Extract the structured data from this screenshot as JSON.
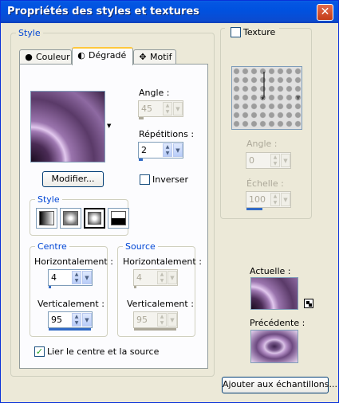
{
  "window": {
    "title": "Propriétés des styles et textures"
  },
  "style_group": {
    "legend": "Style"
  },
  "tabs": [
    {
      "label": "Couleur",
      "icon": "filled-circle-icon"
    },
    {
      "label": "Dégradé",
      "icon": "half-circle-icon"
    },
    {
      "label": "Motif",
      "icon": "pattern-icon"
    }
  ],
  "gradient": {
    "angle_label": "Angle :",
    "angle_value": "45",
    "repetitions_label": "Répétitions :",
    "repetitions_value": "2",
    "modify_label": "Modifier...",
    "invert_label": "Inverser",
    "style_legend": "Style"
  },
  "centre": {
    "legend": "Centre",
    "h_label": "Horizontalement :",
    "h_value": "4",
    "v_label": "Verticalement :",
    "v_value": "95"
  },
  "source": {
    "legend": "Source",
    "h_label": "Horizontalement :",
    "h_value": "4",
    "v_label": "Verticalement :",
    "v_value": "95"
  },
  "link_label": "Lier le centre et la source",
  "texture": {
    "legend": "Texture",
    "angle_label": "Angle :",
    "angle_value": "0",
    "scale_label": "Échelle :",
    "scale_value": "100"
  },
  "current_label": "Actuelle :",
  "previous_label": "Précédente :",
  "add_button_label": "Ajouter aux échantillons...",
  "colors": {
    "titlebar": "#0052e0",
    "accent": "#316ac5",
    "legend": "#0046d5",
    "gradient": "#a07ab3"
  }
}
